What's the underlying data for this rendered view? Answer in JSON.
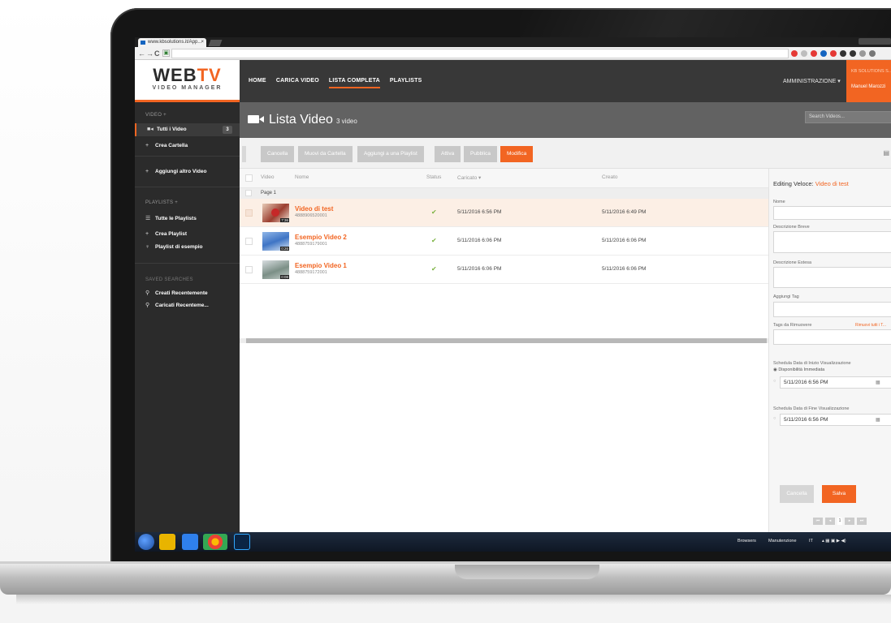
{
  "browser": {
    "tab_title": "www.kbsolutions.it/App...",
    "tab_close": "×",
    "back": "←",
    "forward": "→",
    "reload": "C",
    "lock": "🔒"
  },
  "app": {
    "logo_main": "WEB",
    "logo_accent": "TV",
    "logo_sub": "VIDEO MANAGER",
    "nav": [
      "HOME",
      "CARICA VIDEO",
      "LISTA COMPLETA",
      "PLAYLISTS"
    ],
    "nav_active": "LISTA COMPLETA",
    "admin_label": "AMMINISTRAZIONE ▾",
    "user_org": "KB SOLUTIONS S...",
    "user_name": "Manuel Marozzi"
  },
  "sidebar": {
    "video_head": "VIDEO +",
    "all_videos": "Tutti i Video",
    "all_videos_count": "3",
    "create_folder": "Crea Cartella",
    "add_video": "Aggiungi altro Video",
    "playlists_head": "PLAYLISTS +",
    "all_playlists": "Tutte le Playlists",
    "create_playlist": "Crea Playlist",
    "sample_playlist": "Playlist di esempio",
    "saved_head": "SAVED SEARCHES",
    "recent_created": "Creati Recentemente",
    "recent_uploaded": "Caricati Recenteme..."
  },
  "main": {
    "title": "Lista Video",
    "count": "3 video",
    "search_placeholder": "Search Videos...",
    "toolbar": [
      "Cancella",
      "Muovi da Cartella",
      "Aggiungi a una Playlist",
      "Attiva",
      "Pubblica",
      "Modifica"
    ],
    "columns": {
      "video": "Video",
      "name": "Nome",
      "status": "Status",
      "uploaded": "Caricato ▾",
      "created": "Creato"
    },
    "page_label": "Page 1",
    "rows": [
      {
        "name": "Video di test",
        "id": "4888906520001",
        "duration": "7:36",
        "status": "✔",
        "uploaded": "5/11/2016 6:56 PM",
        "created": "5/11/2016 6:49 PM",
        "selected": true
      },
      {
        "name": "Esempio Video 2",
        "id": "4888759179001",
        "duration": "0:26",
        "status": "✔",
        "uploaded": "5/11/2016 6:06 PM",
        "created": "5/11/2016 6:06 PM",
        "selected": false
      },
      {
        "name": "Esempio Video 1",
        "id": "4888759172001",
        "duration": "0:08",
        "status": "✔",
        "uploaded": "5/11/2016 6:06 PM",
        "created": "5/11/2016 6:06 PM",
        "selected": false
      }
    ]
  },
  "editor": {
    "title_prefix": "Editing Veloce:",
    "title_video": "Video di test",
    "name_label": "Nome",
    "short_desc_label": "Descrizione Breve",
    "long_desc_label": "Descrizione Estesa",
    "add_tag_label": "Aggiungi Tag",
    "remove_tags_label": "Tags da Rimuovere",
    "remove_all_link": "Rimuovi tutti i T...",
    "start_schedule_label": "Schedula Data di Inizio Visualizzazione",
    "immediate_label": "◉ Disponibilità Immediata",
    "start_date": "5/11/2016 6:56 PM",
    "end_schedule_label": "Schedula Data di Fine Visualizzazione",
    "end_date": "5/11/2016 6:56 PM",
    "cancel": "Cancella",
    "save": "Salva",
    "page_number": "1"
  },
  "taskbar": {
    "tray_browsers": "Browsers",
    "tray_maintenance": "Manutenzione",
    "tray_lang": "IT"
  },
  "colors": {
    "accent": "#f26522",
    "header": "#383838",
    "sidebar": "#2b2b2b",
    "title_bar": "#626262"
  }
}
